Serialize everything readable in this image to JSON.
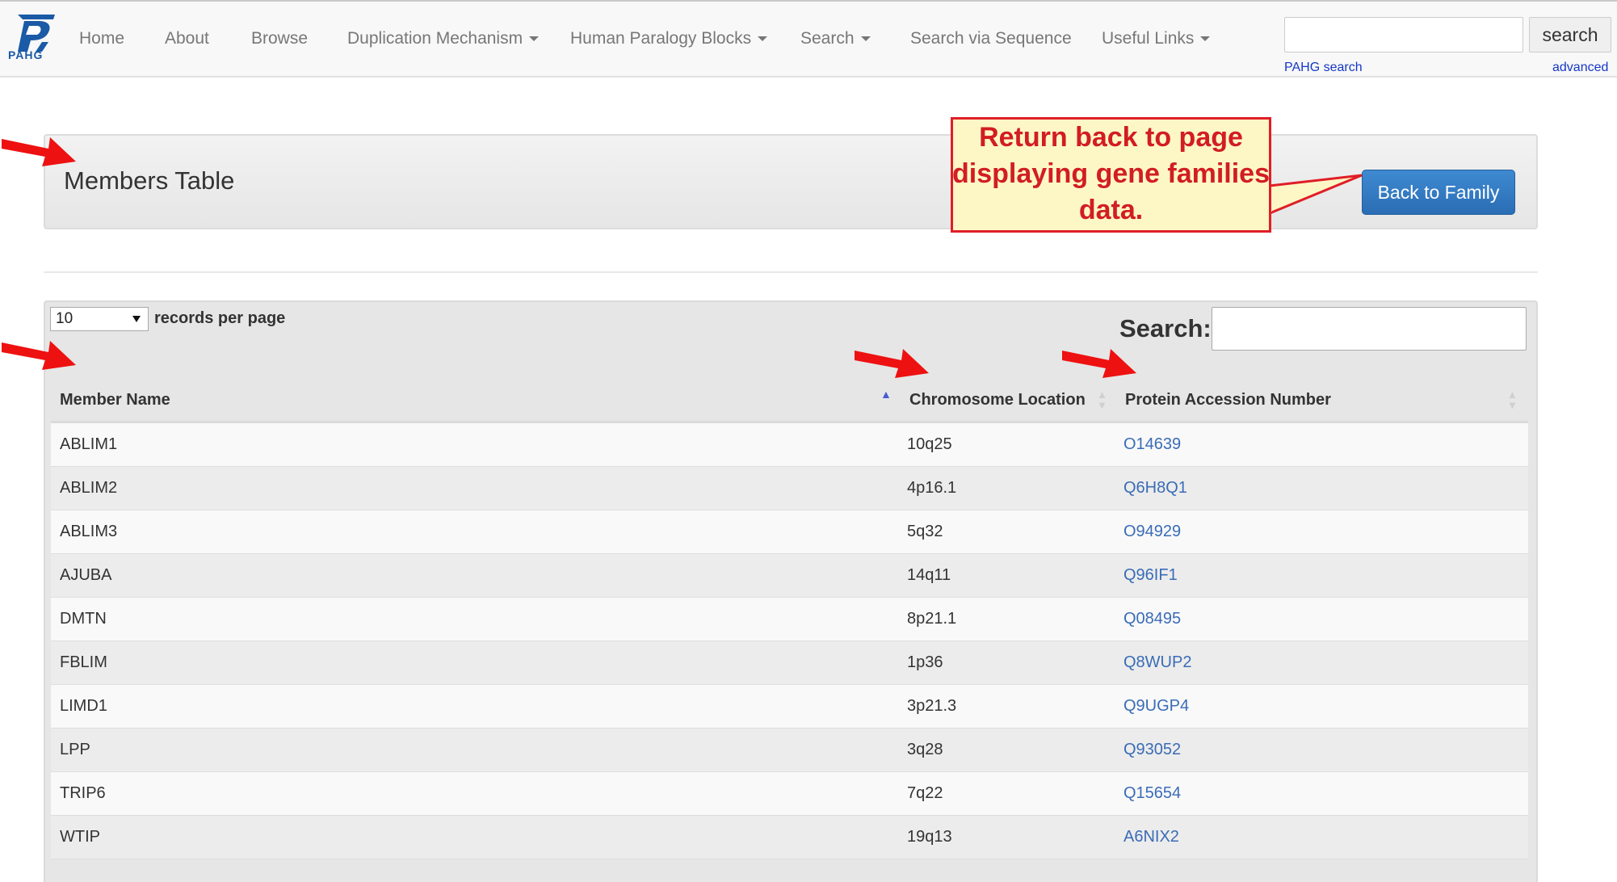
{
  "navbar": {
    "logo_text": "PAHG",
    "items": [
      {
        "label": "Home",
        "dropdown": false
      },
      {
        "label": "About",
        "dropdown": false
      },
      {
        "label": "Browse",
        "dropdown": false
      },
      {
        "label": "Duplication Mechanism",
        "dropdown": true
      },
      {
        "label": "Human Paralogy Blocks",
        "dropdown": true
      },
      {
        "label": "Search",
        "dropdown": true
      },
      {
        "label": "Search via Sequence",
        "dropdown": false
      },
      {
        "label": "Useful Links",
        "dropdown": true
      }
    ],
    "search_button_label": "search",
    "search_input_value": "",
    "pahg_search_link": "PAHG search",
    "advanced_link": "advanced"
  },
  "header": {
    "title": "Members Table",
    "back_button_label": "Back to Family"
  },
  "callout": {
    "text": "Return back to page displaying gene families data."
  },
  "table_controls": {
    "records_per_page_value": "10",
    "records_per_page_label": "records per page",
    "search_label": "Search:",
    "search_value": ""
  },
  "table": {
    "columns": [
      "Member Name",
      "Chromosome Location",
      "Protein Accession Number"
    ],
    "sort_column": "Member Name",
    "sort_direction": "ascending",
    "rows": [
      {
        "name": "ABLIM1",
        "location": "10q25",
        "accession": "O14639"
      },
      {
        "name": "ABLIM2",
        "location": "4p16.1",
        "accession": "Q6H8Q1"
      },
      {
        "name": "ABLIM3",
        "location": "5q32",
        "accession": "O94929"
      },
      {
        "name": "AJUBA",
        "location": "14q11",
        "accession": "Q96IF1"
      },
      {
        "name": "DMTN",
        "location": "8p21.1",
        "accession": "Q08495"
      },
      {
        "name": "FBLIM",
        "location": "1p36",
        "accession": "Q8WUP2"
      },
      {
        "name": "LIMD1",
        "location": "3p21.3",
        "accession": "Q9UGP4"
      },
      {
        "name": "LPP",
        "location": "3q28",
        "accession": "Q93052"
      },
      {
        "name": "TRIP6",
        "location": "7q22",
        "accession": "Q15654"
      },
      {
        "name": "WTIP",
        "location": "19q13",
        "accession": "A6NIX2"
      }
    ]
  },
  "colors": {
    "link": "#3a6cb7",
    "button_primary": "#2a6db4",
    "annotation_red": "#e01e26",
    "callout_fill": "#fdf7c6"
  }
}
